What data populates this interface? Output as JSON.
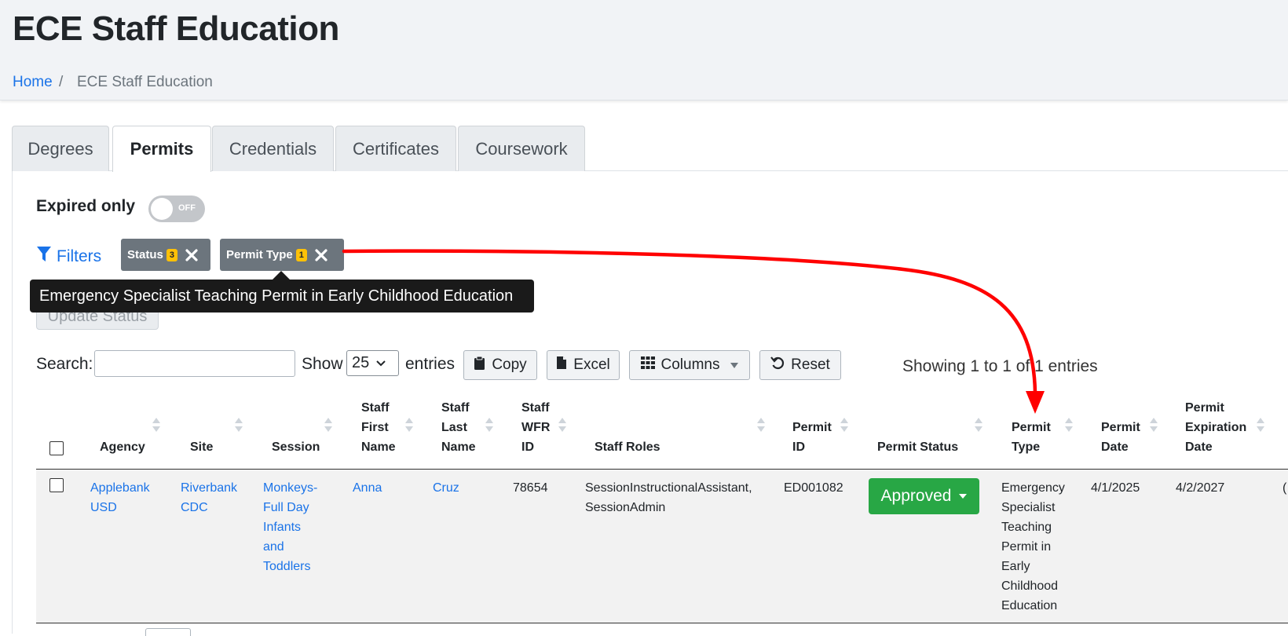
{
  "page": {
    "title": "ECE Staff Education",
    "breadcrumb": {
      "home": "Home",
      "separator": "/",
      "current": "ECE Staff Education"
    }
  },
  "tabs": [
    {
      "label": "Degrees",
      "active": false
    },
    {
      "label": "Permits",
      "active": true
    },
    {
      "label": "Credentials",
      "active": false
    },
    {
      "label": "Certificates",
      "active": false
    },
    {
      "label": "Coursework",
      "active": false
    }
  ],
  "toggle": {
    "label": "Expired only",
    "state_text": "OFF"
  },
  "filters": {
    "label": "Filters",
    "chips": [
      {
        "label": "Status",
        "count": "3"
      },
      {
        "label": "Permit Type",
        "count": "1"
      }
    ]
  },
  "tooltip": {
    "text": "Emergency Specialist Teaching Permit in Early Childhood Education"
  },
  "update_status_label": "Update Status",
  "controls": {
    "search_label": "Search:",
    "search_value": "",
    "show_label": "Show",
    "page_size": "25",
    "entries_label": "entries",
    "copy": "Copy",
    "excel": "Excel",
    "columns": "Columns",
    "reset": "Reset",
    "showing": "Showing 1 to 1 of 1 entries"
  },
  "table": {
    "headers": {
      "agency": "Agency",
      "site": "Site",
      "session": "Session",
      "staff_first_name": [
        "Staff",
        "First",
        "Name"
      ],
      "staff_last_name": [
        "Staff",
        "Last",
        "Name"
      ],
      "staff_wfr_id": [
        "Staff",
        "WFR",
        "ID"
      ],
      "staff_roles": "Staff Roles",
      "permit_id": [
        "Permit",
        "ID"
      ],
      "permit_status": "Permit Status",
      "permit_type": [
        "Permit",
        "Type"
      ],
      "permit_date": [
        "Permit",
        "Date"
      ],
      "permit_expiration_date": [
        "Permit",
        "Expiration",
        "Date"
      ]
    },
    "rows": [
      {
        "agency": [
          "Applebank",
          "USD"
        ],
        "site": [
          "Riverbank",
          "CDC"
        ],
        "session": [
          "Monkeys-",
          "Full Day",
          "Infants",
          "and",
          "Toddlers"
        ],
        "first_name": "Anna",
        "last_name": "Cruz",
        "wfr_id": "78654",
        "roles": [
          "SessionInstructionalAssistant,",
          "SessionAdmin"
        ],
        "permit_id": "ED001082",
        "status": "Approved",
        "permit_type": [
          "Emergency",
          "Specialist",
          "Teaching",
          "Permit in",
          "Early",
          "Childhood",
          "Education"
        ],
        "permit_date": "4/1/2025",
        "expiration_date": "4/2/2027",
        "trailing_cell": "("
      }
    ]
  },
  "colors": {
    "link": "#1a73e8",
    "approved": "#28a745",
    "chip": "#6c757d",
    "chip_count": "#ffc107",
    "annotation_arrow": "#ff0000"
  }
}
